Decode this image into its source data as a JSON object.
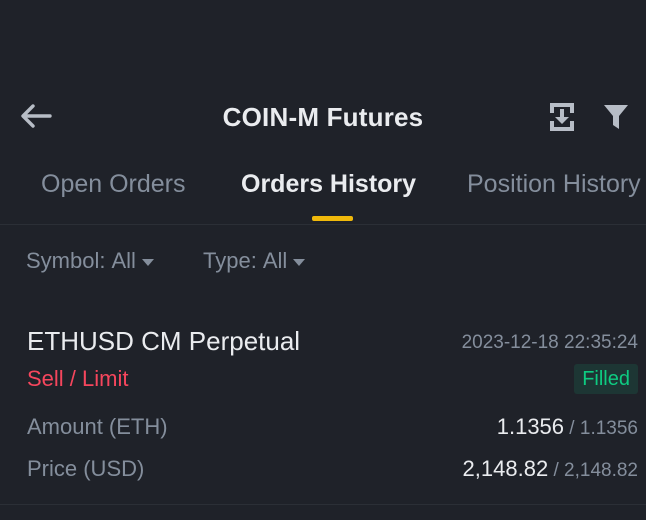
{
  "header": {
    "back_icon": "arrow-left-icon",
    "title": "COIN-M Futures",
    "export_icon": "export-icon",
    "filter_icon": "funnel-icon"
  },
  "tabs": [
    {
      "label": "Open Orders",
      "active": false
    },
    {
      "label": "Orders History",
      "active": true
    },
    {
      "label": "Position History",
      "active": false
    }
  ],
  "filters": {
    "symbol_label": "Symbol:",
    "symbol_value": "All",
    "type_label": "Type:",
    "type_value": "All"
  },
  "order": {
    "symbol": "ETHUSD CM Perpetual",
    "time": "2023-12-18 22:35:24",
    "side": "Sell / Limit",
    "status": "Filled",
    "amount_label": "Amount (ETH)",
    "amount_filled": "1.1356",
    "amount_separator": " / ",
    "amount_total": "1.1356",
    "price_label": "Price (USD)",
    "price_avg": "2,148.82",
    "price_separator": " / ",
    "price_order": "2,148.82"
  },
  "colors": {
    "background": "#1f2229",
    "accent": "#f0b90b",
    "sell": "#f6465d",
    "filled": "#0ecb81",
    "muted": "#848e9c",
    "text": "#eaecef"
  }
}
